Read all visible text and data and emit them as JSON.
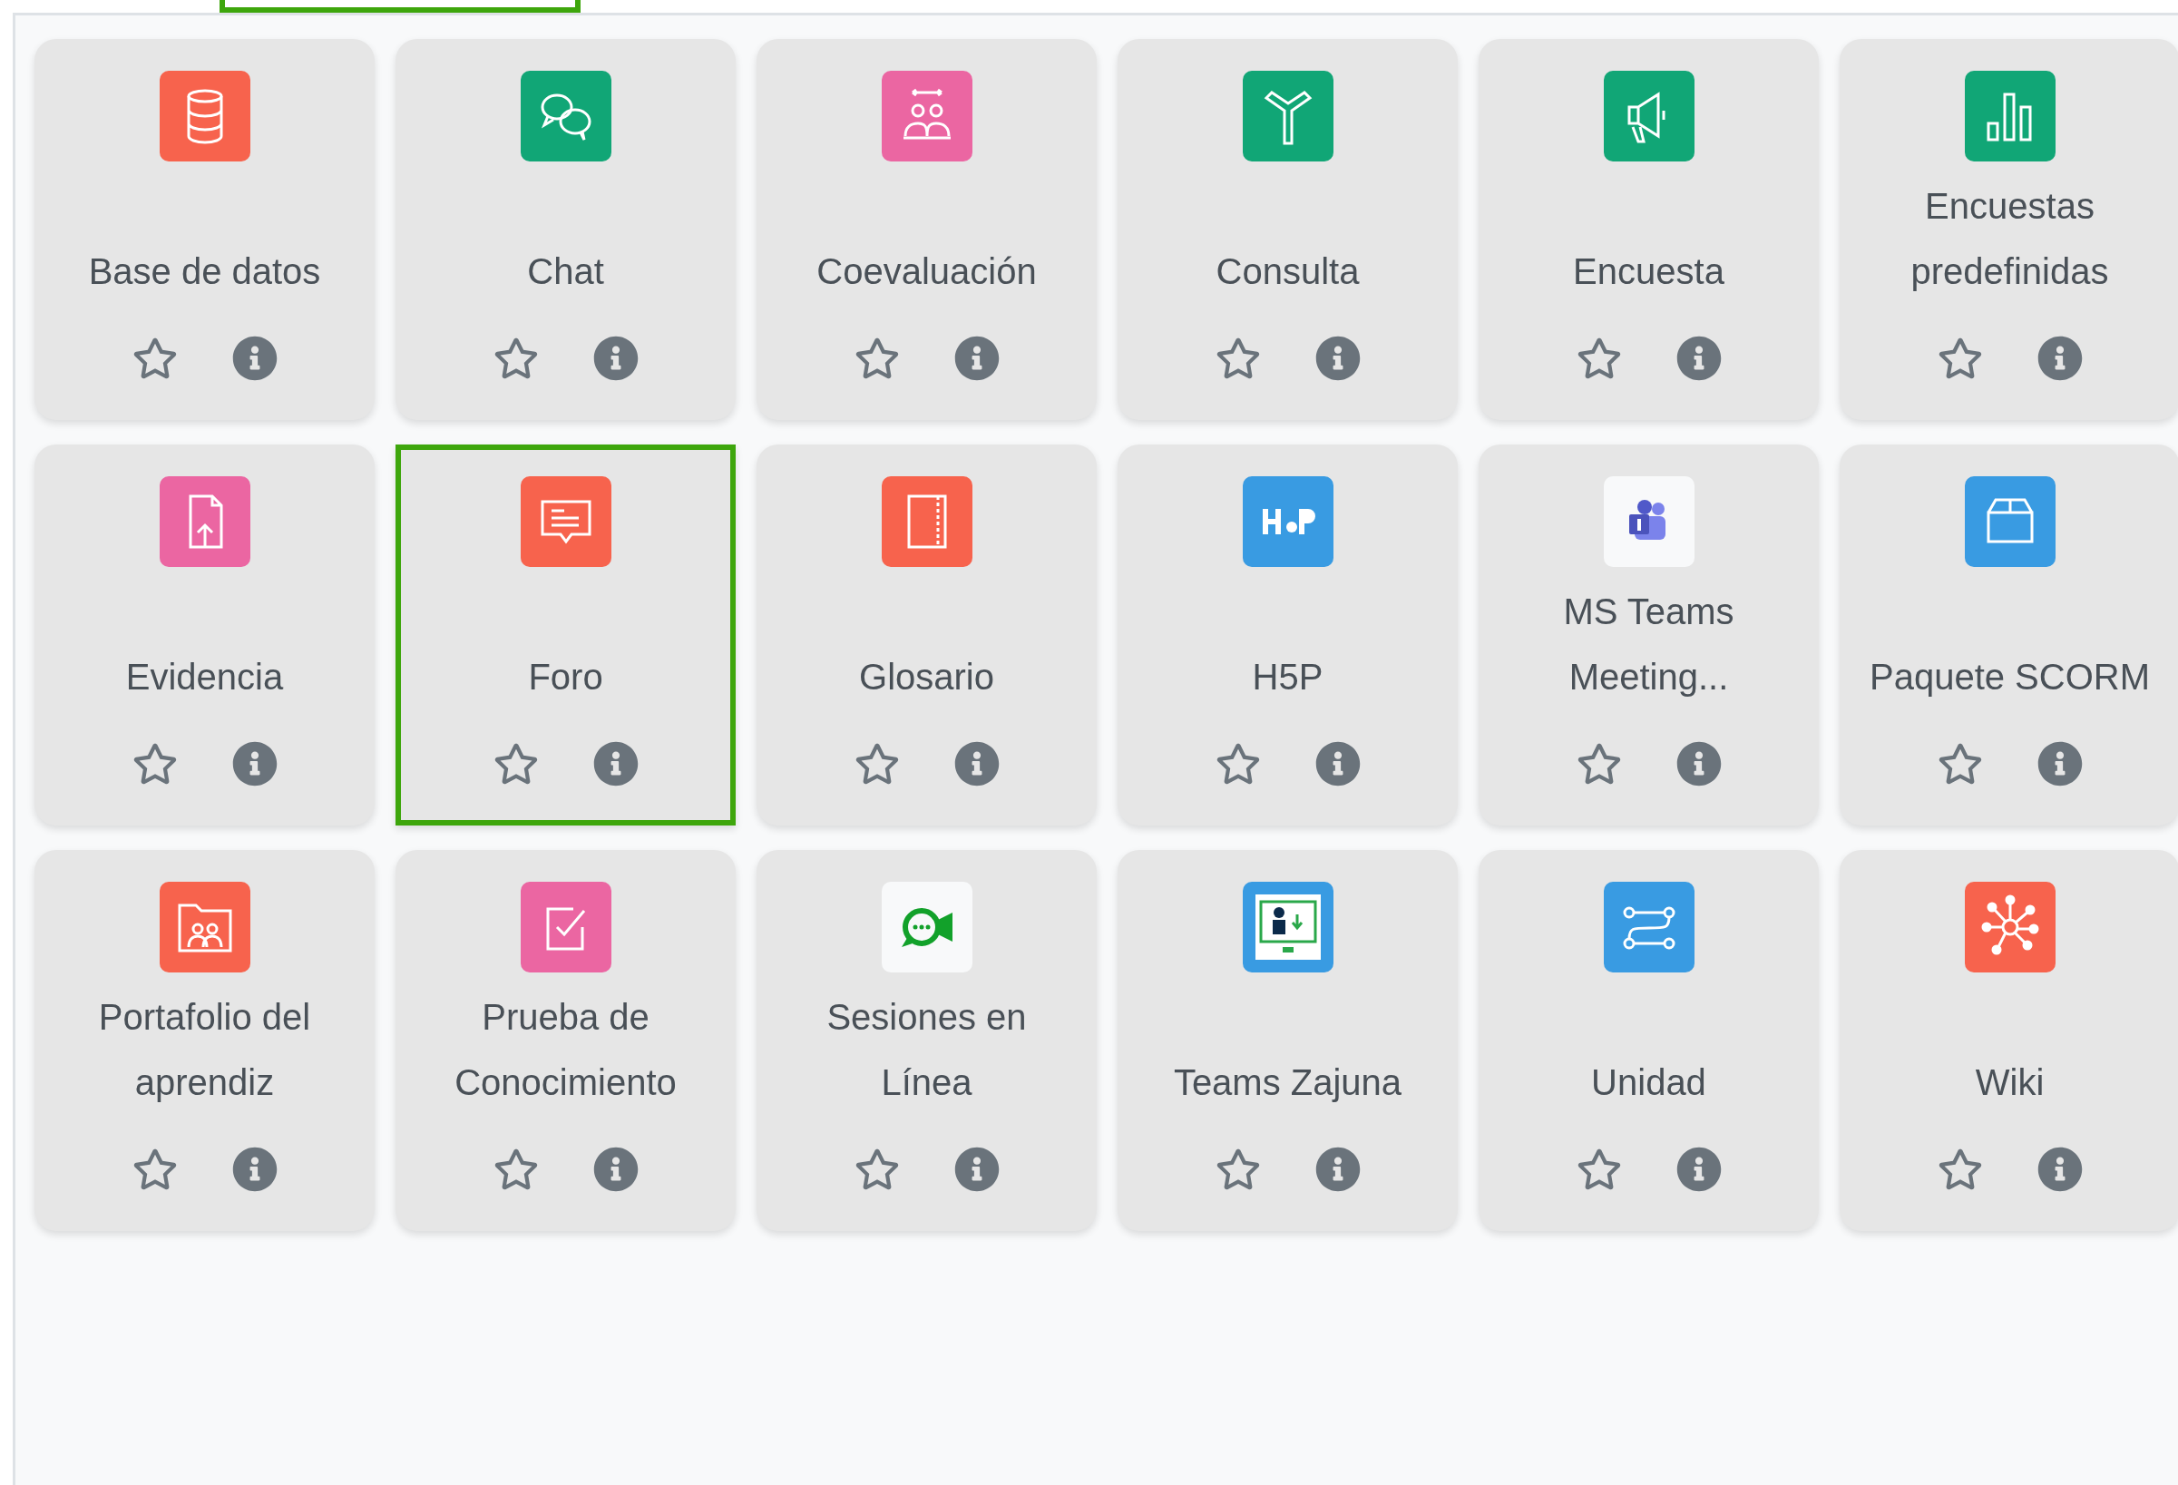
{
  "activities": [
    {
      "name": "Base de datos",
      "kind": "database",
      "color": "#f7634d",
      "selected": false,
      "starred": false
    },
    {
      "name": "Chat",
      "kind": "chat",
      "color": "#11a676",
      "selected": false,
      "starred": false
    },
    {
      "name": "Coevaluación",
      "kind": "people",
      "color": "#eb66a2",
      "selected": false,
      "starred": false
    },
    {
      "name": "Consulta",
      "kind": "signpost",
      "color": "#11a676",
      "selected": false,
      "starred": false
    },
    {
      "name": "Encuesta",
      "kind": "megaphone",
      "color": "#11a676",
      "selected": false,
      "starred": false
    },
    {
      "name": "Encuestas predefinidas",
      "kind": "barchart",
      "color": "#11a676",
      "selected": false,
      "starred": false
    },
    {
      "name": "Evidencia",
      "kind": "upload",
      "color": "#eb66a2",
      "selected": false,
      "starred": false
    },
    {
      "name": "Foro",
      "kind": "message",
      "color": "#f7634d",
      "selected": true,
      "starred": false
    },
    {
      "name": "Glosario",
      "kind": "book",
      "color": "#f7634d",
      "selected": false,
      "starred": false
    },
    {
      "name": "H5P",
      "kind": "h5p",
      "color": "#399be2",
      "selected": false,
      "starred": false
    },
    {
      "name": "MS Teams Meeting...",
      "kind": "teams",
      "color": "#f8f9fa",
      "selected": false,
      "starred": false
    },
    {
      "name": "Paquete SCORM",
      "kind": "box",
      "color": "#399be2",
      "selected": false,
      "starred": false
    },
    {
      "name": "Portafolio del aprendiz",
      "kind": "folder",
      "color": "#f7634d",
      "selected": false,
      "starred": false
    },
    {
      "name": "Prueba de Conocimiento",
      "kind": "checkbox",
      "color": "#eb66a2",
      "selected": false,
      "starred": false
    },
    {
      "name": "Sesiones en Línea",
      "kind": "videochat",
      "color": "#f8f9fa",
      "selected": false,
      "starred": false
    },
    {
      "name": "Teams Zajuna",
      "kind": "monitor",
      "color": "#399be2",
      "selected": false,
      "starred": false
    },
    {
      "name": "Unidad",
      "kind": "route",
      "color": "#399be2",
      "selected": false,
      "starred": false
    },
    {
      "name": "Wiki",
      "kind": "network",
      "color": "#f7634d",
      "selected": false,
      "starred": false
    }
  ]
}
